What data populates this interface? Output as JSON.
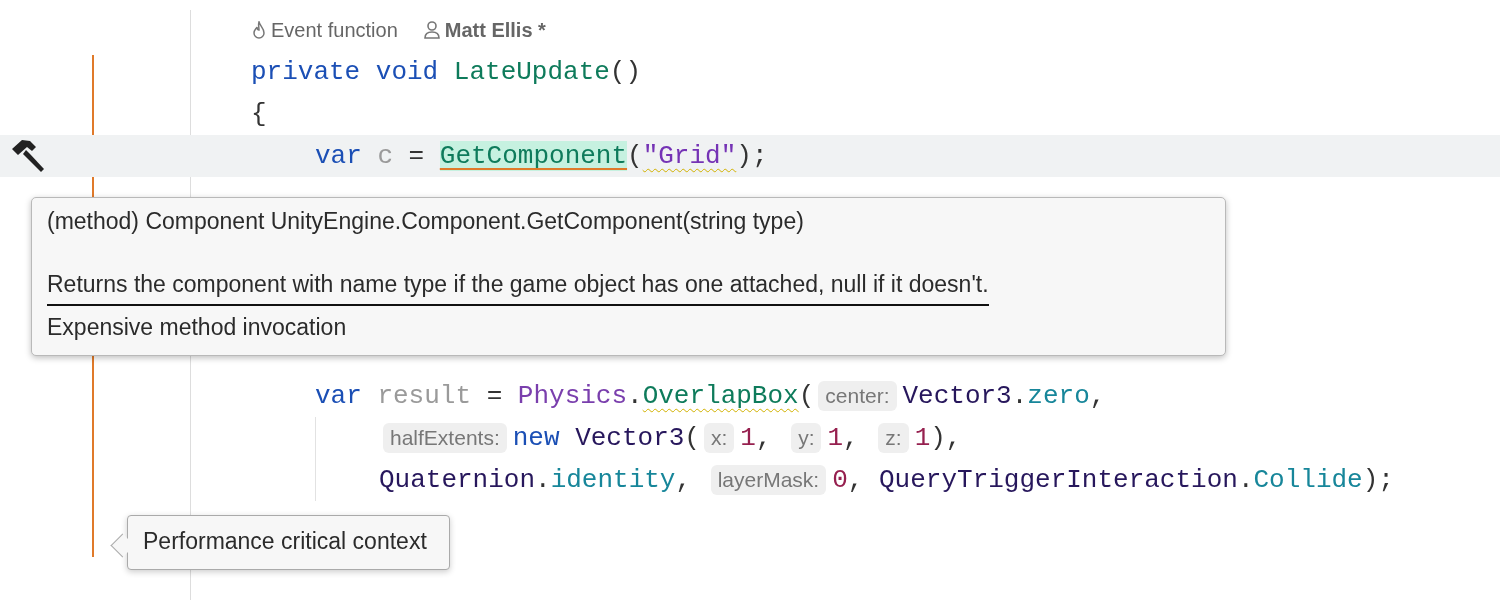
{
  "editor": {
    "meta": [
      {
        "kind": "event",
        "text": "Event function"
      },
      {
        "kind": "author",
        "text": "Matt Ellis *"
      }
    ],
    "lines": [
      {
        "current": false,
        "words": [
          [
            {
              "text": "private",
              "kind": "keyword"
            }
          ],
          [
            {
              "text": "void",
              "kind": "keyword"
            }
          ],
          [
            {
              "text": "LateUpdate",
              "kind": "method"
            },
            {
              "text": "()",
              "kind": "punct"
            }
          ]
        ]
      },
      {
        "current": false,
        "words": [
          [
            {
              "text": "{",
              "kind": "punct"
            }
          ]
        ],
        "children": [
          {
            "current": true,
            "marked": true,
            "words": [
              [
                {
                  "text": "var",
                  "kind": "keyword"
                }
              ],
              [
                {
                  "text": "c",
                  "kind": "local"
                }
              ],
              [
                {
                  "text": "=",
                  "kind": "punct"
                }
              ],
              [
                {
                  "text": "GetComponent",
                  "kind": "method",
                  "highlighted": true
                },
                {
                  "text": "(",
                  "kind": "punct"
                },
                {
                  "text": "\"Grid\"",
                  "kind": "string",
                  "warning": true
                },
                {
                  "text": ");",
                  "kind": "punct"
                }
              ]
            ],
            "popup": {
              "signature": "(method) Component UnityEngine.Component.GetComponent(string type)",
              "description": "Returns the component with name type if the game object has one attached, null if it doesn't.",
              "warning": "Expensive method invocation"
            }
          },
          {
            "current": false,
            "words": [
              [
                {
                  "text": "var",
                  "kind": "keyword"
                }
              ],
              [
                {
                  "text": "result",
                  "kind": "local"
                }
              ],
              [
                {
                  "text": "=",
                  "kind": "punct"
                }
              ],
              [
                {
                  "text": "Physics",
                  "kind": "static_class"
                },
                {
                  "text": ".",
                  "kind": "punct"
                },
                {
                  "text": "OverlapBox",
                  "kind": "method",
                  "warning": true
                },
                {
                  "text": "(",
                  "kind": "punct"
                },
                {
                  "text": "center:",
                  "kind": "hint"
                },
                {
                  "text": "Vector3",
                  "kind": "type"
                },
                {
                  "text": ".",
                  "kind": "punct"
                },
                {
                  "text": "zero",
                  "kind": "field"
                },
                {
                  "text": ",",
                  "kind": "punct"
                }
              ]
            ],
            "children": [
              {
                "current": false,
                "words": [
                  [
                    {
                      "text": "halfExtents:",
                      "kind": "hint"
                    },
                    {
                      "text": "new",
                      "kind": "keyword"
                    }
                  ],
                  [
                    {
                      "text": "Vector3",
                      "kind": "type"
                    },
                    {
                      "text": "(",
                      "kind": "punct"
                    },
                    {
                      "text": "x:",
                      "kind": "hint"
                    },
                    {
                      "text": "1",
                      "kind": "number"
                    },
                    {
                      "text": ",",
                      "kind": "punct"
                    }
                  ],
                  [
                    {
                      "text": "y:",
                      "kind": "hint"
                    },
                    {
                      "text": "1",
                      "kind": "number"
                    },
                    {
                      "text": ",",
                      "kind": "punct"
                    }
                  ],
                  [
                    {
                      "text": "z:",
                      "kind": "hint"
                    },
                    {
                      "text": "1",
                      "kind": "number"
                    },
                    {
                      "text": "),",
                      "kind": "punct"
                    }
                  ]
                ]
              },
              {
                "current": false,
                "words": [
                  [
                    {
                      "text": "Quaternion",
                      "kind": "type"
                    },
                    {
                      "text": ".",
                      "kind": "punct"
                    },
                    {
                      "text": "identity",
                      "kind": "field"
                    },
                    {
                      "text": ",",
                      "kind": "punct"
                    }
                  ],
                  [
                    {
                      "text": "layerMask:",
                      "kind": "hint"
                    },
                    {
                      "text": "0",
                      "kind": "number"
                    },
                    {
                      "text": ",",
                      "kind": "punct"
                    }
                  ],
                  [
                    {
                      "text": "QueryTriggerInteraction",
                      "kind": "type"
                    },
                    {
                      "text": ".",
                      "kind": "punct"
                    },
                    {
                      "text": "Collide",
                      "kind": "field"
                    },
                    {
                      "text": ");",
                      "kind": "punct"
                    }
                  ]
                ]
              }
            ]
          }
        ]
      }
    ],
    "tooltip": {
      "text": "Performance critical context"
    }
  }
}
